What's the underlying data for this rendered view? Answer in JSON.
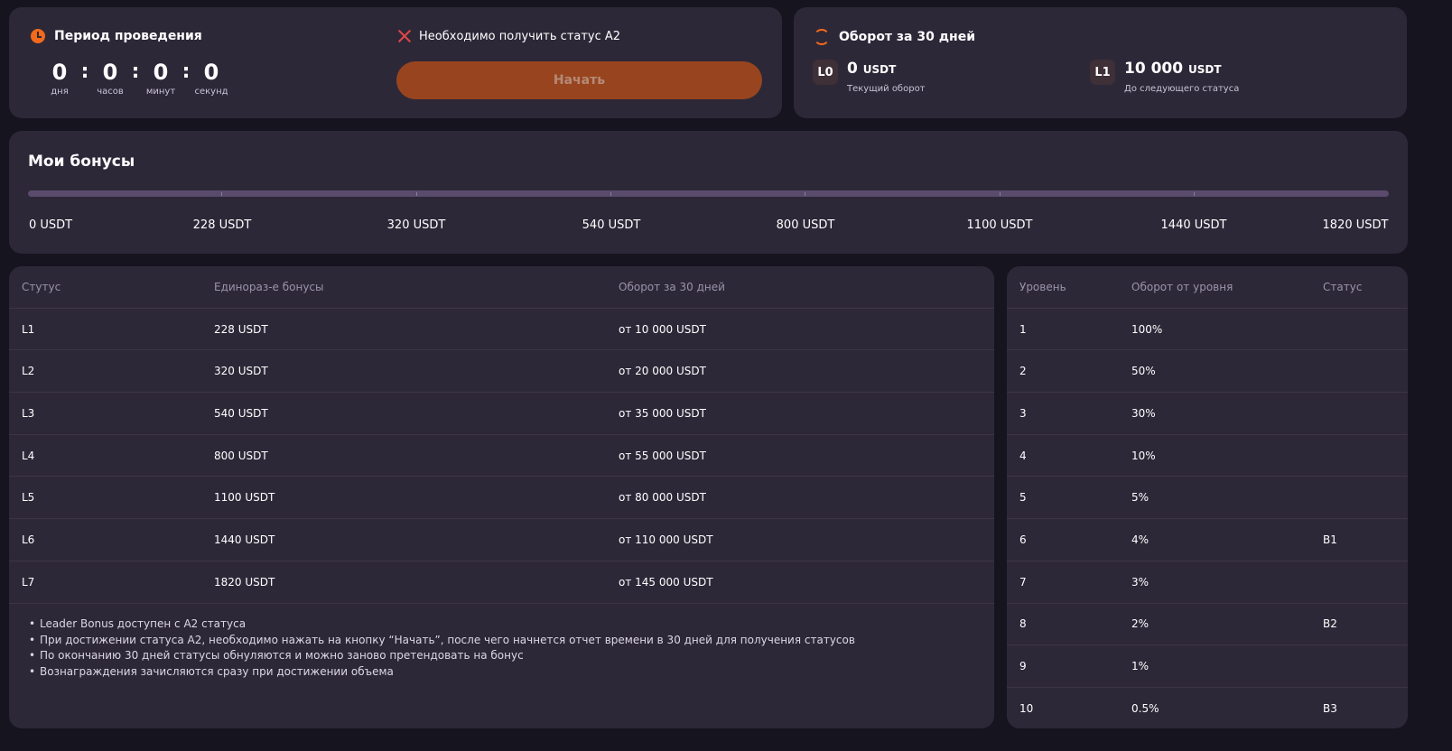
{
  "period": {
    "title": "Период проведения",
    "icon": "clock-icon",
    "timer": [
      {
        "value": "0",
        "label": "дня"
      },
      {
        "value": "0",
        "label": "часов"
      },
      {
        "value": "0",
        "label": "минут"
      },
      {
        "value": "0",
        "label": "секунд"
      }
    ],
    "separator": ":",
    "requirement": "Необходимо получить статус А2",
    "start_label": "Начать"
  },
  "turnover": {
    "title": "Оборот за 30 дней",
    "current": {
      "badge": "L0",
      "value": "0",
      "unit": "USDT",
      "desc": "Текущий оборот"
    },
    "next": {
      "badge": "L1",
      "value": "10 000",
      "unit": "USDT",
      "desc": "До следующего статуса"
    }
  },
  "bonuses": {
    "title": "Мои бонусы",
    "milestones": [
      "0 USDT",
      "228 USDT",
      "320 USDT",
      "540 USDT",
      "800 USDT",
      "1100 USDT",
      "1440 USDT",
      "1820 USDT"
    ]
  },
  "status_table": {
    "headers": [
      "Стутус",
      "Единораз-е бонусы",
      "Оборот за 30 дней"
    ],
    "rows": [
      [
        "L1",
        "228 USDT",
        "от 10 000 USDT"
      ],
      [
        "L2",
        "320 USDT",
        "от 20 000 USDT"
      ],
      [
        "L3",
        "540 USDT",
        "от 35 000 USDT"
      ],
      [
        "L4",
        "800 USDT",
        "от 55 000 USDT"
      ],
      [
        "L5",
        "1100 USDT",
        "от 80 000 USDT"
      ],
      [
        "L6",
        "1440 USDT",
        "от 110 000 USDT"
      ],
      [
        "L7",
        "1820 USDT",
        "от 145 000 USDT"
      ]
    ],
    "notes": [
      "Leader Bonus доступен с A2 статуса",
      "При достижении статуса A2, необходимо нажать на кнопку “Начать”, после чего начнется отчет времени в 30 дней для получения статусов",
      "По окончанию 30 дней статусы обнуляются и можно заново претендовать на бонус",
      "Вознаграждения зачисляются сразу при достижении объема"
    ]
  },
  "levels_table": {
    "headers": [
      "Уровень",
      "Оборот от уровня",
      "Статус"
    ],
    "rows": [
      [
        "1",
        "100%",
        ""
      ],
      [
        "2",
        "50%",
        ""
      ],
      [
        "3",
        "30%",
        ""
      ],
      [
        "4",
        "10%",
        ""
      ],
      [
        "5",
        "5%",
        ""
      ],
      [
        "6",
        "4%",
        "B1"
      ],
      [
        "7",
        "3%",
        ""
      ],
      [
        "8",
        "2%",
        "B2"
      ],
      [
        "9",
        "1%",
        ""
      ],
      [
        "10",
        "0.5%",
        "B3"
      ]
    ]
  },
  "colors": {
    "accent": "#f26a1b",
    "button": "#98451f",
    "card": "#2d2838",
    "background": "#16141f"
  }
}
